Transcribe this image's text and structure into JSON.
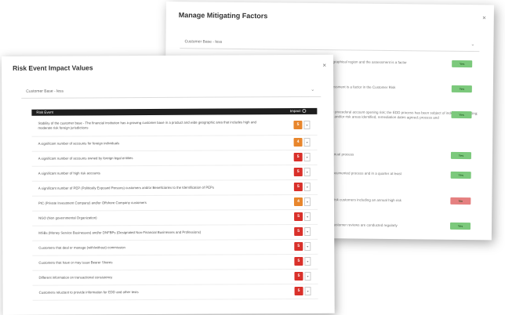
{
  "mitigating_dialog": {
    "title": "Manage Mitigating Factors",
    "close_icon": "×",
    "dropdown_value": "Customer Base - less",
    "rows": [
      {
        "text": "...geographical region and the assessment is a factor",
        "toggle": "Yes",
        "color": "#7cc97c"
      },
      {
        "text": "...assessment is a factor in the Customer Risk",
        "toggle": "Yes",
        "color": "#7cc97c"
      },
      {
        "text": "...EDD procedural account opening risk; the EDD process has been subject of independent testing; issues and/or risk areas identified, remediation dates agreed; process and",
        "toggle": "Yes",
        "color": "#7cc97c"
      },
      {
        "text": "...a manual process",
        "toggle": "Yes",
        "color": "#7cc97c"
      },
      {
        "text": "...be documented process and in a quarter at least",
        "toggle": "Yes",
        "color": "#7cc97c"
      },
      {
        "text": "...high risk customers including an annual high risk",
        "toggle": "No",
        "color": "#e58080"
      },
      {
        "text": "...and customer reviews are conducted regularly",
        "toggle": "Yes",
        "color": "#7cc97c"
      }
    ]
  },
  "impact_dialog": {
    "title": "Risk Event Impact Values",
    "close_icon": "×",
    "dropdown_value": "Customer Base - less",
    "table_headers": {
      "event": "Risk Event",
      "impact": "Impact"
    },
    "rows": [
      {
        "text": "Stability of the customer base - The financial institution has a growing customer base in a product and wide geographic area that includes high and moderate risk foreign jurisdictions",
        "impact": "5",
        "color": "#e8862c"
      },
      {
        "text": "A significant number of accounts for foreign individuals",
        "impact": "4",
        "color": "#e8862c"
      },
      {
        "text": "A significant number of accounts owned by foreign legal entities",
        "impact": "5",
        "color": "#d9302a"
      },
      {
        "text": "A significant number of high risk accounts",
        "impact": "5",
        "color": "#d9302a"
      },
      {
        "text": "A significant number of PEP (Politically Exposed Persons) customers and/or Beneficiaries to the Identification of PEPs",
        "impact": "5",
        "color": "#d9302a"
      },
      {
        "text": "PIC (Private Investment Company) and/or Offshore Company customers",
        "impact": "4",
        "color": "#e8862c"
      },
      {
        "text": "NGO (Non governmental Organization)",
        "impact": "5",
        "color": "#d9302a"
      },
      {
        "text": "MSBs (Money Service Businesses) and/or DNFBPs (Designated Non-Financial Businesses and Professions)",
        "impact": "5",
        "color": "#d9302a"
      },
      {
        "text": "Customers that deal or manage (with/without) commission",
        "impact": "5",
        "color": "#d9302a"
      },
      {
        "text": "Customers that have or may issue Bearer Shares",
        "impact": "5",
        "color": "#d9302a"
      },
      {
        "text": "Different information on transactional consistency",
        "impact": "5",
        "color": "#d9302a"
      },
      {
        "text": "Customers reluctant to provide information for EDD and other tests",
        "impact": "5",
        "color": "#d9302a"
      }
    ]
  }
}
